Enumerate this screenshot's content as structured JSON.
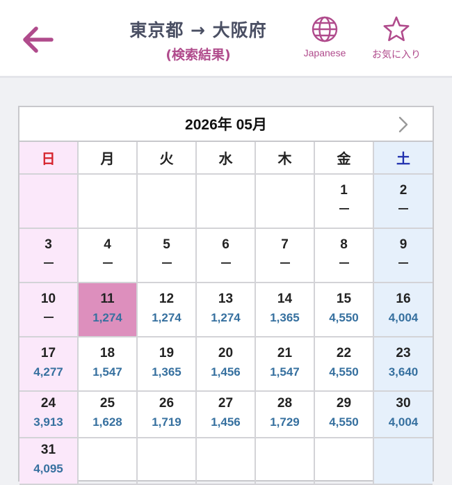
{
  "header": {
    "route_title": "東京都 → 大阪府",
    "route_subtitle": "(検索結果)",
    "language_label": "Japanese",
    "favorites_label": "お気に入り",
    "accent_color": "#b04b8c"
  },
  "calendar": {
    "month_label": "2026年 05月",
    "weekdays": [
      "日",
      "月",
      "火",
      "水",
      "木",
      "金",
      "土"
    ],
    "selected_day": "11",
    "weeks": [
      [
        null,
        null,
        null,
        null,
        null,
        {
          "day": "1",
          "price": null
        },
        {
          "day": "2",
          "price": null
        }
      ],
      [
        {
          "day": "3",
          "price": null
        },
        {
          "day": "4",
          "price": null
        },
        {
          "day": "5",
          "price": null
        },
        {
          "day": "6",
          "price": null
        },
        {
          "day": "7",
          "price": null
        },
        {
          "day": "8",
          "price": null
        },
        {
          "day": "9",
          "price": null
        }
      ],
      [
        {
          "day": "10",
          "price": null
        },
        {
          "day": "11",
          "price": "1,274"
        },
        {
          "day": "12",
          "price": "1,274"
        },
        {
          "day": "13",
          "price": "1,274"
        },
        {
          "day": "14",
          "price": "1,365"
        },
        {
          "day": "15",
          "price": "4,550"
        },
        {
          "day": "16",
          "price": "4,004"
        }
      ],
      [
        {
          "day": "17",
          "price": "4,277"
        },
        {
          "day": "18",
          "price": "1,547"
        },
        {
          "day": "19",
          "price": "1,365"
        },
        {
          "day": "20",
          "price": "1,456"
        },
        {
          "day": "21",
          "price": "1,547"
        },
        {
          "day": "22",
          "price": "4,550"
        },
        {
          "day": "23",
          "price": "3,640"
        }
      ],
      [
        {
          "day": "24",
          "price": "3,913"
        },
        {
          "day": "25",
          "price": "1,628"
        },
        {
          "day": "26",
          "price": "1,719"
        },
        {
          "day": "27",
          "price": "1,456"
        },
        {
          "day": "28",
          "price": "1,729"
        },
        {
          "day": "29",
          "price": "4,550"
        },
        {
          "day": "30",
          "price": "4,004"
        }
      ],
      [
        {
          "day": "31",
          "price": "4,095"
        },
        null,
        null,
        null,
        null,
        null,
        null
      ]
    ]
  },
  "icons": {
    "back": "arrow-left-icon",
    "language": "globe-icon",
    "favorites": "star-outline-icon",
    "next_month": "chevron-right-icon"
  }
}
